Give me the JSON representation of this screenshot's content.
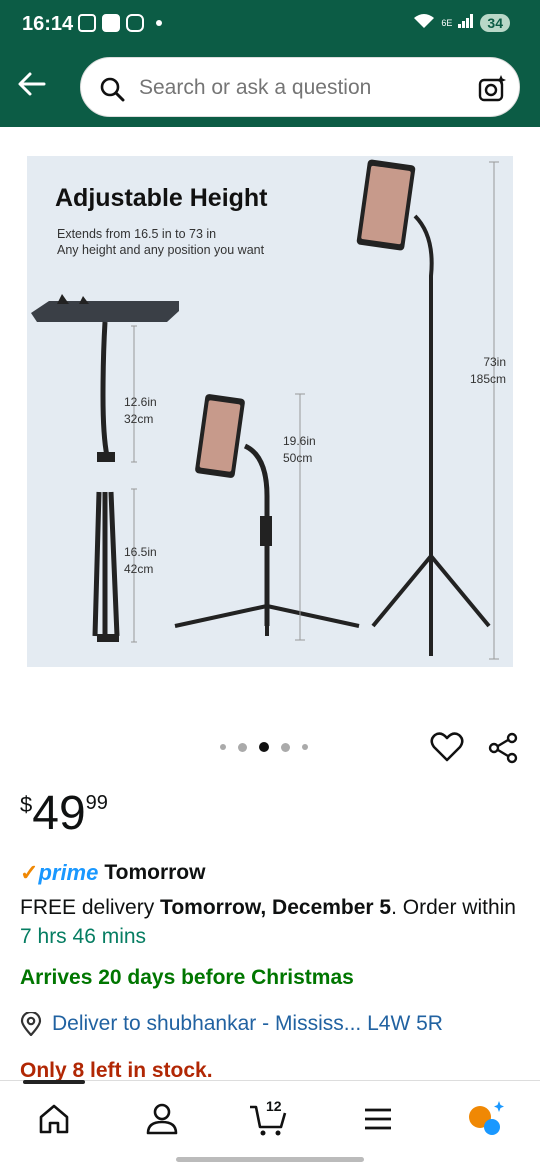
{
  "status_bar": {
    "time": "16:14",
    "battery": "34",
    "network": "6E"
  },
  "header": {
    "search_placeholder": "Search or ask a question"
  },
  "product_image": {
    "title": "Adjustable Height",
    "subtitle_line1": "Extends from 16.5 in to 73 in",
    "subtitle_line2": "Any height and any position you want",
    "m1_in": "12.6in",
    "m1_cm": "32cm",
    "m2_in": "16.5in",
    "m2_cm": "42cm",
    "m3_in": "19.6in",
    "m3_cm": "50cm",
    "m4_in": "73in",
    "m4_cm": "185cm"
  },
  "carousel": {
    "count": 5,
    "active_index": 2
  },
  "price": {
    "currency": "$",
    "whole": "49",
    "fraction": "99"
  },
  "prime": {
    "check": "✓",
    "word": "prime",
    "day": "Tomorrow"
  },
  "delivery": {
    "prefix": "FREE delivery ",
    "date": "Tomorrow, December 5",
    "middle": ". Order within ",
    "countdown": "7 hrs 46 mins"
  },
  "arrives": "Arrives 20 days before Christmas",
  "deliver_to": "Deliver to shubhankar - Mississ... L4W 5R",
  "stock": "Only 8 left in stock.",
  "bottom_nav": {
    "cart_count": "12"
  },
  "colors": {
    "header": "#0c5c45",
    "link": "#2162a1",
    "prime": "#1a98ff",
    "green": "#007600",
    "stock": "#b12704"
  }
}
